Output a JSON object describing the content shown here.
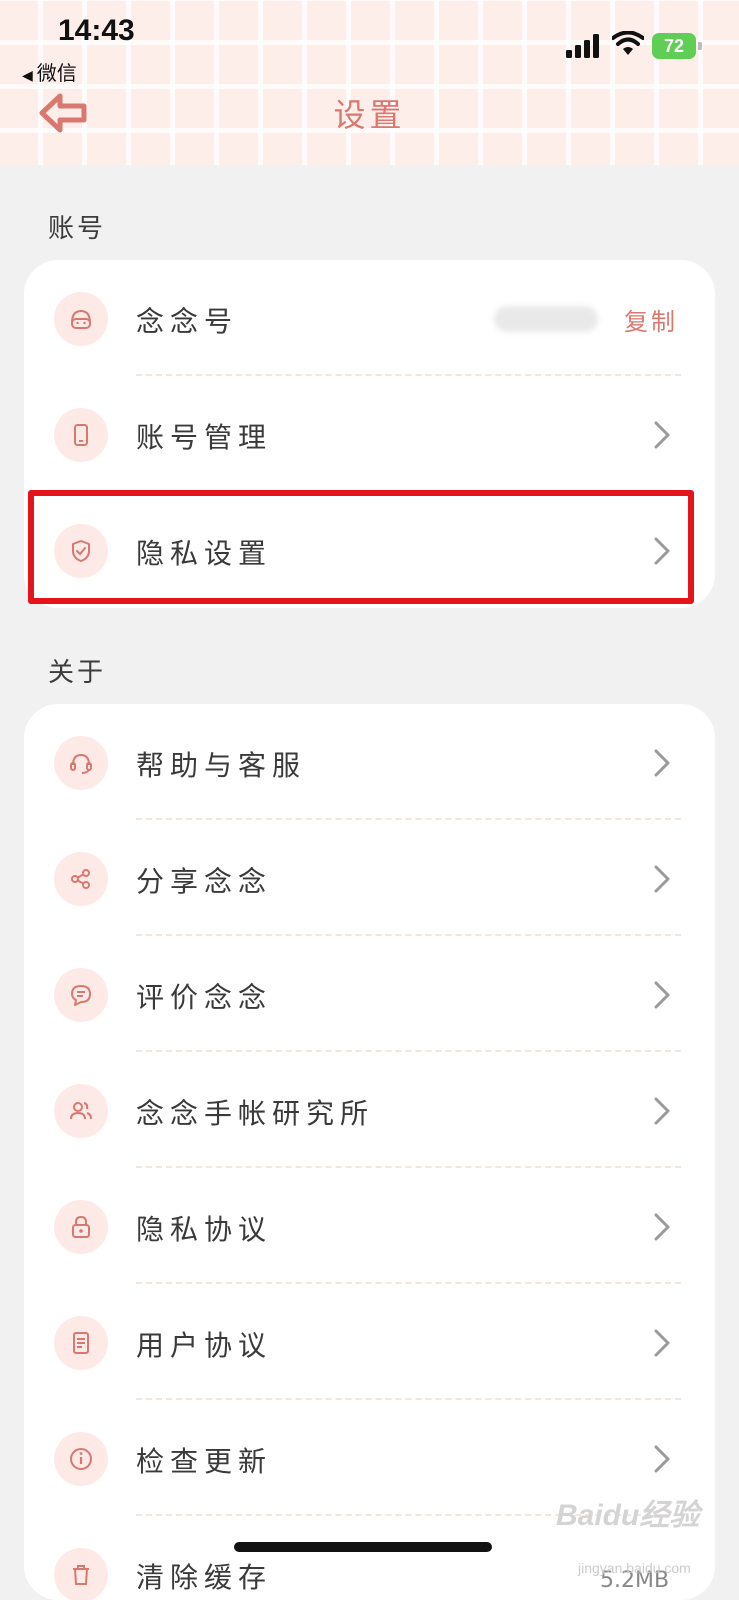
{
  "status_bar": {
    "time": "14:43",
    "back_app": "微信",
    "battery": "72"
  },
  "header": {
    "title": "设置"
  },
  "colors": {
    "accent": "#d9786f",
    "icon_bg": "#fdeae6",
    "highlight": "#e5141b",
    "battery": "#5fce55"
  },
  "sections": [
    {
      "label": "账号",
      "items": [
        {
          "label": "念念号",
          "icon": "avatar-face-icon",
          "action": "复制"
        },
        {
          "label": "账号管理",
          "icon": "phone-icon"
        },
        {
          "label": "隐私设置",
          "icon": "shield-check-icon"
        }
      ]
    },
    {
      "label": "关于",
      "items": [
        {
          "label": "帮助与客服",
          "icon": "headset-icon"
        },
        {
          "label": "分享念念",
          "icon": "share-icon"
        },
        {
          "label": "评价念念",
          "icon": "chat-bubble-icon"
        },
        {
          "label": "念念手帐研究所",
          "icon": "users-icon"
        },
        {
          "label": "隐私协议",
          "icon": "lock-icon"
        },
        {
          "label": "用户协议",
          "icon": "document-icon"
        },
        {
          "label": "检查更新",
          "icon": "info-icon"
        },
        {
          "label": "清除缓存",
          "icon": "trash-icon",
          "value": "5.2MB"
        }
      ]
    }
  ],
  "watermark": {
    "brand": "Baidu经验",
    "url": "jingyan.baidu.com"
  }
}
